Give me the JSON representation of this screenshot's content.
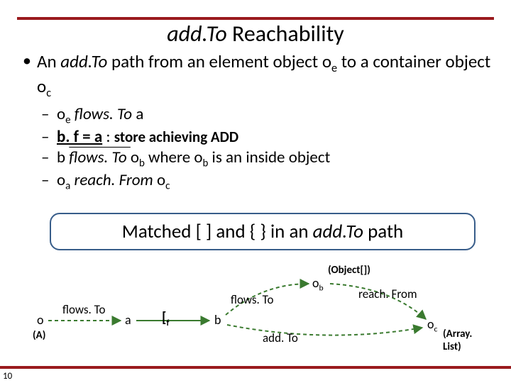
{
  "page_number": "10",
  "title": {
    "ital": "add.To",
    "rest": " Reachability"
  },
  "main_bullet": {
    "pre": "An ",
    "ital": "add.To",
    "mid": " path from an element object o",
    "sub1": "e",
    "mid2": " to a container object o",
    "sub2": "c"
  },
  "sub_bullets": [
    {
      "pre": "o",
      "sub": "e",
      "ital": " flows. To ",
      "post": "a"
    },
    {
      "bold_ul": "b. f = a",
      "rest": " : ",
      "bold_rest": "store achieving ADD"
    },
    {
      "pre": "b ",
      "ital": "flows. To ",
      "ul": "",
      "mid": "o",
      "sub": "b",
      "mid2": " where o",
      "sub2": "b",
      "post": " is an inside object"
    },
    {
      "pre": "o",
      "sub": "a",
      "ital": " reach. From ",
      "mid": "o",
      "sub2": "c",
      "post": ""
    }
  ],
  "boxed": {
    "pre": "Matched [  ] and { } in an ",
    "ital": "add.To",
    "post": " path"
  },
  "diagram": {
    "o": "o",
    "A": "(A)",
    "flowsTo_left": "flows. To",
    "a": "a",
    "bracket_f": "[",
    "f_sub": "f",
    "b": "b",
    "flowsTo_top": "flows. To",
    "ob": "o",
    "ob_sub": "b",
    "obj_arr": "(Object[])",
    "addTo": "add. To",
    "reachFrom": "reach. From",
    "oc": "o",
    "oc_sub": "c",
    "arraylist": "(Array. List)"
  }
}
